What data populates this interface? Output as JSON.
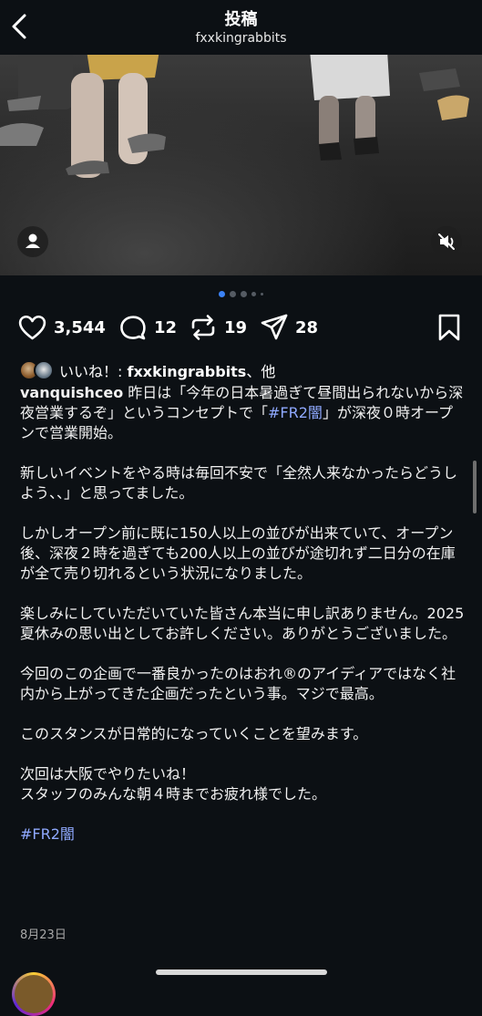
{
  "header": {
    "title": "投稿",
    "username": "fxxkingrabbits"
  },
  "media": {
    "carousel_count": 5,
    "active_index": 0
  },
  "actions": {
    "likes": "3,544",
    "comments": "12",
    "reposts": "19",
    "shares": "28"
  },
  "liked_by": {
    "prefix": "いいね！: ",
    "user": "fxxkingrabbits",
    "suffix": "、他"
  },
  "caption": {
    "username": "vanquishceo",
    "part1": " 昨日は「今年の日本暑過ぎて昼間出られないから深夜営業するぞ」というコンセプトで「",
    "hashtag_inline": "#FR2闇",
    "part2": "」が深夜０時オープンで営業開始。\n\n新しいイベントをやる時は毎回不安で「全然人来なかったらどうしよう、、」と思ってました。\n\nしかしオープン前に既に150人以上の並びが出来ていて、オープン後、深夜２時を過ぎても200人以上の並びが途切れず二日分の在庫が全て売り切れるという状況になりました。\n\n楽しみにしていただいていた皆さん本当に申し訳ありません。2025夏休みの思い出としてお許しください。ありがとうございました。\n\n今回のこの企画で一番良かったのはおれ®のアイディアではなく社内から上がってきた企画だったという事。マジで最高。\n\nこのスタンスが日常的になっていくことを望みます。\n\n次回は大阪でやりたいね！\nスタッフのみんな朝４時までお疲れ様でした。\n\n",
    "hashtag_end": "#FR2闇"
  },
  "date": "8月23日",
  "colors": {
    "background": "#0c1014",
    "hashtag": "#8fa9ff",
    "carousel_active": "#3b82f6"
  }
}
